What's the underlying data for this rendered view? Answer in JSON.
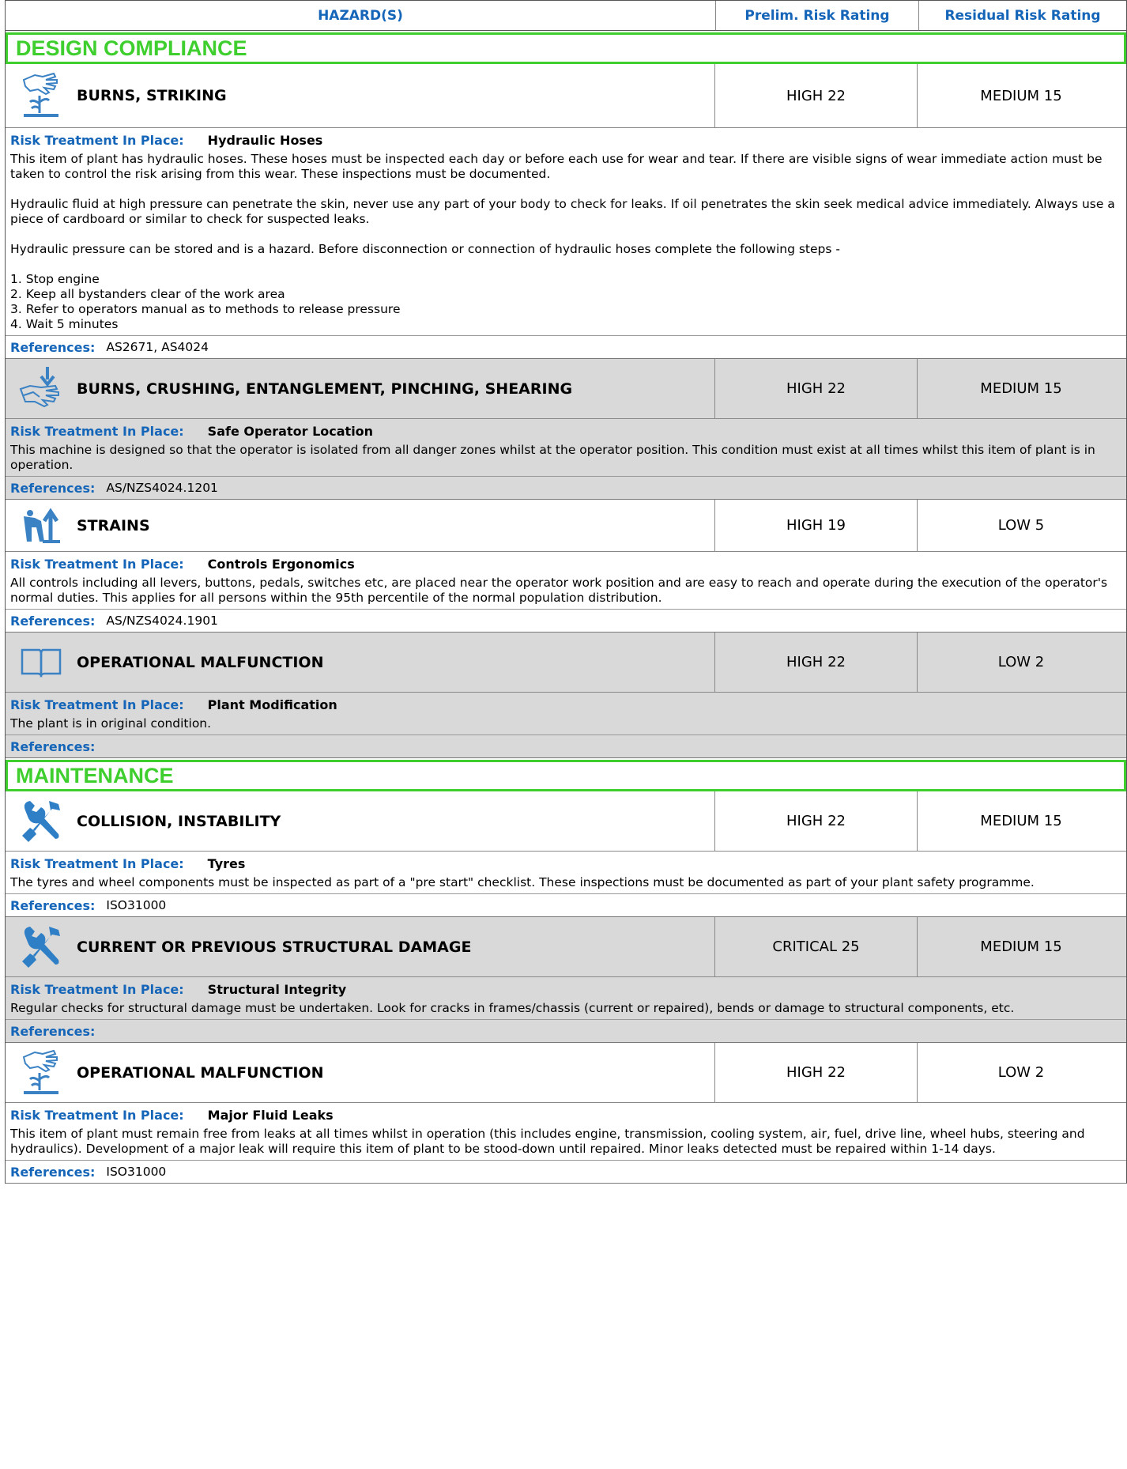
{
  "header": {
    "hazards_label": "HAZARD(S)",
    "prelim_label": "Prelim. Risk Rating",
    "residual_label": "Residual Risk Rating"
  },
  "labels": {
    "treatment": "Risk Treatment In Place:",
    "references": "References:"
  },
  "sections": [
    {
      "title": "DESIGN COMPLIANCE",
      "hazards": [
        {
          "icon": "hand-plant-icon",
          "title": "BURNS, STRIKING",
          "prelim": "HIGH 22",
          "residual": "MEDIUM 15",
          "treatment": "Hydraulic Hoses",
          "paragraphs": [
            "This item of plant has hydraulic hoses. These hoses must be inspected each day or before each use for wear and tear. If there are visible signs of wear immediate action must be taken to control the risk arising from this wear. These inspections must be documented.",
            "Hydraulic fluid at high pressure can penetrate the skin, never use any part of your body to check for leaks. If oil penetrates the skin seek medical advice immediately. Always use a piece of cardboard or similar to check for suspected leaks.",
            "Hydraulic pressure can be stored and is a hazard. Before disconnection or connection of hydraulic hoses complete the following steps -",
            "1. Stop engine\n2. Keep all bystanders clear of the work area\n3. Refer to operators manual as to methods to release pressure\n4. Wait 5 minutes"
          ],
          "references": "AS2671, AS4024"
        },
        {
          "icon": "hand-arrow-icon",
          "title": "BURNS, CRUSHING, ENTANGLEMENT, PINCHING, SHEARING",
          "prelim": "HIGH 22",
          "residual": "MEDIUM 15",
          "treatment": "Safe Operator Location",
          "paragraphs": [
            "This machine is designed so that the operator is isolated from all danger zones whilst at the operator position. This condition must exist at all times whilst this item of plant is in operation."
          ],
          "references": "AS/NZS4024.1201"
        },
        {
          "icon": "worker-strain-icon",
          "title": "STRAINS",
          "prelim": "HIGH 19",
          "residual": "LOW 5",
          "treatment": "Controls Ergonomics",
          "paragraphs": [
            "All controls including all levers, buttons, pedals, switches etc, are placed near the operator work position and are easy to reach and operate during the execution of the operator's normal duties. This applies for all persons within the 95th percentile of the normal population distribution."
          ],
          "references": "AS/NZS4024.1901"
        },
        {
          "icon": "open-book-icon",
          "title": "OPERATIONAL MALFUNCTION",
          "prelim": "HIGH 22",
          "residual": "LOW 2",
          "treatment": "Plant Modification",
          "paragraphs": [
            "The plant is in original condition."
          ],
          "references": ""
        }
      ]
    },
    {
      "title": "MAINTENANCE",
      "hazards": [
        {
          "icon": "wrench-screwdriver-icon",
          "title": "COLLISION, INSTABILITY",
          "prelim": "HIGH 22",
          "residual": "MEDIUM 15",
          "treatment": "Tyres",
          "paragraphs": [
            "The tyres and wheel components must be inspected as part of a \"pre start\" checklist. These inspections must be documented as part of your plant safety programme."
          ],
          "references": "ISO31000"
        },
        {
          "icon": "wrench-screwdriver-icon",
          "title": "CURRENT OR PREVIOUS STRUCTURAL DAMAGE",
          "prelim": "CRITICAL 25",
          "residual": "MEDIUM 15",
          "treatment": "Structural Integrity",
          "paragraphs": [
            "Regular checks for structural damage must be undertaken. Look for cracks in frames/chassis (current or repaired), bends or damage to structural components, etc."
          ],
          "references": ""
        },
        {
          "icon": "hand-plant-icon",
          "title": "OPERATIONAL MALFUNCTION",
          "prelim": "HIGH 22",
          "residual": "LOW 2",
          "treatment": "Major Fluid Leaks",
          "paragraphs": [
            "This item of plant must remain free from leaks at all times whilst in operation (this includes engine, transmission, cooling system, air, fuel, drive line, wheel hubs, steering and hydraulics). Development of a major leak will require this item of plant to be stood-down until repaired. Minor leaks detected must be repaired within 1-14 days."
          ],
          "references": "ISO31000"
        }
      ]
    }
  ]
}
